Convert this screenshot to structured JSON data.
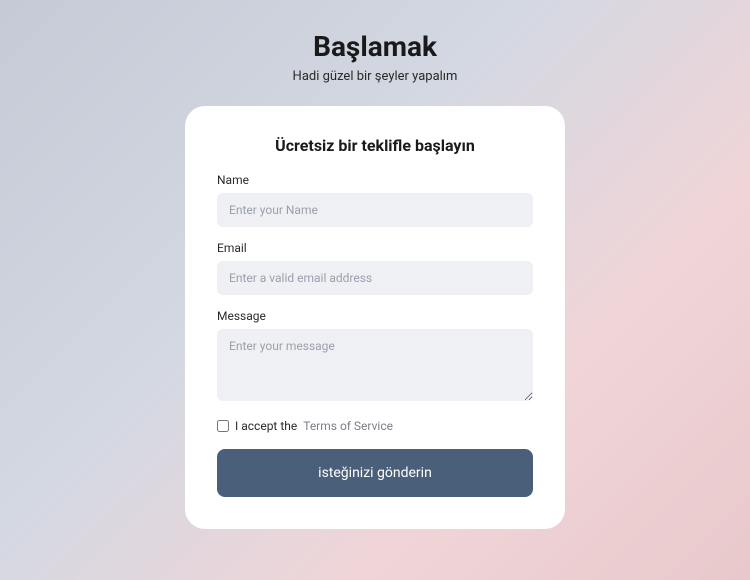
{
  "header": {
    "title": "Başlamak",
    "subtitle": "Hadi güzel bir şeyler yapalım"
  },
  "form": {
    "title": "Ücretsiz bir teklifle başlayın",
    "fields": {
      "name": {
        "label": "Name",
        "placeholder": "Enter your Name",
        "value": ""
      },
      "email": {
        "label": "Email",
        "placeholder": "Enter a valid email address",
        "value": ""
      },
      "message": {
        "label": "Message",
        "placeholder": "Enter your message",
        "value": ""
      }
    },
    "terms": {
      "prefix": "I accept the ",
      "link": "Terms of Service",
      "checked": false
    },
    "submit_label": "isteğinizi gönderin"
  }
}
